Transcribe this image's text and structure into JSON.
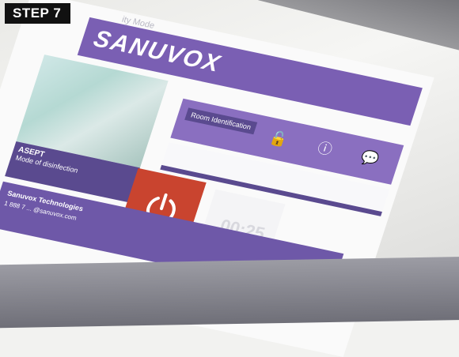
{
  "step_badge": "STEP 7",
  "brand": {
    "name": "SANUVOX",
    "color": "#7a5fb3"
  },
  "top_text": "ity Mode",
  "header": {
    "room_label": "Room Identification",
    "icons": [
      "lock-icon",
      "info-icon",
      "chat-icon"
    ]
  },
  "photo_caption": {
    "line1": "ASEPT",
    "line2": "Mode of disinfection"
  },
  "power": {
    "color": "#c9442f"
  },
  "counter": {
    "value": "00:25"
  },
  "support": {
    "title": "Sanuvox Technologies",
    "phone": "1 888 7 ... @sanuvox.com"
  }
}
